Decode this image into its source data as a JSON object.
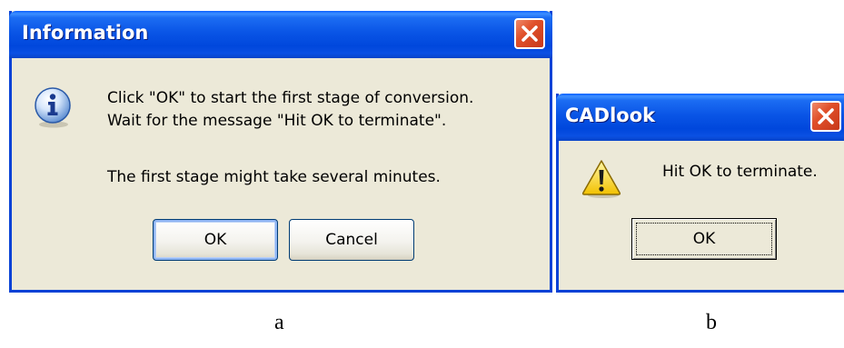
{
  "dialog_a": {
    "title": "Information",
    "icon": "info-icon",
    "message_line1": "Click \"OK\" to start the first stage of conversion.",
    "message_line2": "Wait for the message \"Hit OK to terminate\".",
    "message_line3": "The first stage might take several minutes.",
    "ok_label": "OK",
    "cancel_label": "Cancel"
  },
  "dialog_b": {
    "title": "CADlook",
    "icon": "warning-icon",
    "message": "Hit OK to terminate.",
    "ok_label": "OK"
  },
  "captions": {
    "a": "a",
    "b": "b"
  },
  "colors": {
    "titlebar": "#0a55e6",
    "frame": "#0842d6",
    "body": "#ece9d8",
    "close": "#e0502a"
  }
}
